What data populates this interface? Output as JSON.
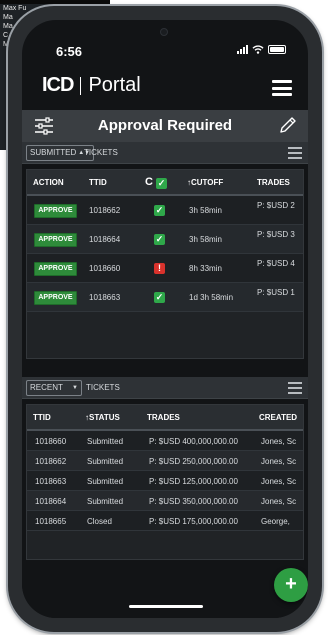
{
  "background_window": {
    "lines": [
      "Max Fu",
      "Ma",
      "Ma",
      "C",
      "M"
    ]
  },
  "status_bar": {
    "time": "6:56"
  },
  "header": {
    "logo": "ICD",
    "app_name": "Portal",
    "menu_icon": "hamburger-icon"
  },
  "titlebar": {
    "title": "Approval Required",
    "left_icon": "filter-sliders-icon",
    "right_icon": "pencil-icon"
  },
  "approval_section": {
    "filter_value": "SUBMITTED",
    "label": "TICKETS",
    "columns": [
      "ACTION",
      "TTID",
      "C",
      "CUTOFF",
      "TRADES"
    ],
    "rows": [
      {
        "action": "APPROVE",
        "ttid": "1018662",
        "check": "ok",
        "cutoff": "3h 58min",
        "trades": "P: $USD 2"
      },
      {
        "action": "APPROVE",
        "ttid": "1018664",
        "check": "ok",
        "cutoff": "3h 58min",
        "trades": "P: $USD 3"
      },
      {
        "action": "APPROVE",
        "ttid": "1018660",
        "check": "bad",
        "cutoff": "8h 33min",
        "trades": "P: $USD 4"
      },
      {
        "action": "APPROVE",
        "ttid": "1018663",
        "check": "ok",
        "cutoff": "1d 3h 58min",
        "trades": "P: $USD 1"
      }
    ]
  },
  "recent_section": {
    "filter_value": "RECENT",
    "label": "TICKETS",
    "columns": [
      "TTID",
      "STATUS",
      "TRADES",
      "CREATED"
    ],
    "rows": [
      {
        "ttid": "1018660",
        "status": "Submitted",
        "trades": "P: $USD 400,000,000.00",
        "created": "Jones, Sc"
      },
      {
        "ttid": "1018662",
        "status": "Submitted",
        "trades": "P: $USD 250,000,000.00",
        "created": "Jones, Sc"
      },
      {
        "ttid": "1018663",
        "status": "Submitted",
        "trades": "P: $USD 125,000,000.00",
        "created": "Jones, Sc"
      },
      {
        "ttid": "1018664",
        "status": "Submitted",
        "trades": "P: $USD 350,000,000.00",
        "created": "Jones, Sc"
      },
      {
        "ttid": "1018665",
        "status": "Closed",
        "trades": "P: $USD 175,000,000.00",
        "created": "George, "
      }
    ]
  },
  "fab": {
    "label": "+"
  },
  "colors": {
    "accent_green": "#2e8b3a",
    "alert_red": "#d9322c",
    "header_bar": "#3a3e42",
    "screen_bg": "#121416"
  }
}
